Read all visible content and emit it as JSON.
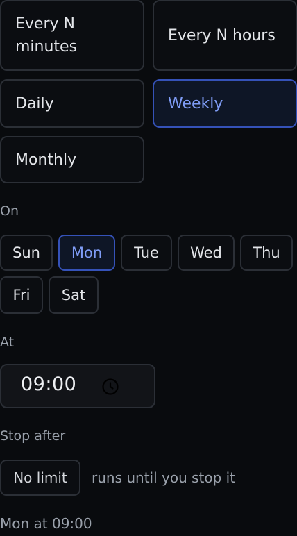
{
  "frequency": {
    "options": [
      {
        "label": "Every N\nminutes"
      },
      {
        "label": "Every N hours"
      },
      {
        "label": "Daily"
      },
      {
        "label": "Weekly",
        "selected": true
      },
      {
        "label": "Monthly"
      }
    ]
  },
  "on": {
    "label": "On",
    "days": [
      "Sun",
      "Mon",
      "Tue",
      "Wed",
      "Thu",
      "Fri",
      "Sat"
    ],
    "selected_day": "Mon"
  },
  "at": {
    "label": "At",
    "time_value": "09:00",
    "icon": "clock-icon"
  },
  "stop_after": {
    "label": "Stop after",
    "button_label": "No limit",
    "hint": "runs until you stop it"
  },
  "summary": "Mon at 09:00",
  "colors": {
    "background": "#090b0e",
    "border": "#2b2f36",
    "accent": "#7f9cf5",
    "accent_border": "#3552b8",
    "muted_text": "#9aa1ab"
  }
}
